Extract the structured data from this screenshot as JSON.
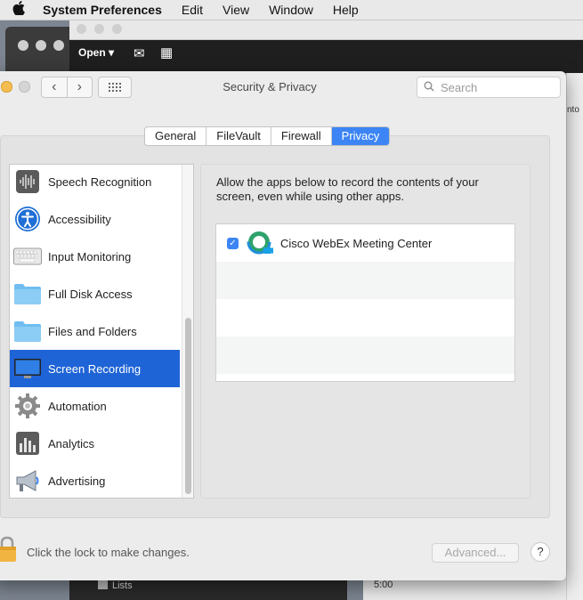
{
  "menubar": {
    "apple_icon": "apple-icon",
    "app_name": "System Preferences",
    "menus": [
      "Edit",
      "View",
      "Window",
      "Help"
    ]
  },
  "background": {
    "open_label": "Open",
    "right_snippet": "nto",
    "lists_label": "Lists",
    "time_label": "5:00"
  },
  "window": {
    "title": "Security & Privacy",
    "search_placeholder": "Search",
    "tabs": [
      {
        "label": "General",
        "active": false
      },
      {
        "label": "FileVault",
        "active": false
      },
      {
        "label": "Firewall",
        "active": false
      },
      {
        "label": "Privacy",
        "active": true
      }
    ],
    "privacy_list": [
      {
        "label": "Speech Recognition",
        "icon": "waveform-icon",
        "selected": false
      },
      {
        "label": "Accessibility",
        "icon": "accessibility-icon",
        "selected": false
      },
      {
        "label": "Input Monitoring",
        "icon": "keyboard-icon",
        "selected": false
      },
      {
        "label": "Full Disk Access",
        "icon": "folder-icon",
        "selected": false
      },
      {
        "label": "Files and Folders",
        "icon": "folder-icon",
        "selected": false
      },
      {
        "label": "Screen Recording",
        "icon": "display-icon",
        "selected": true
      },
      {
        "label": "Automation",
        "icon": "gear-icon",
        "selected": false
      },
      {
        "label": "Analytics",
        "icon": "bar-chart-icon",
        "selected": false
      },
      {
        "label": "Advertising",
        "icon": "megaphone-icon",
        "selected": false
      }
    ],
    "description": "Allow the apps below to record the contents of your screen, even while using other apps.",
    "apps": [
      {
        "name": "Cisco WebEx Meeting Center",
        "checked": true,
        "icon": "webex-icon"
      }
    ],
    "lock_text": "Click the lock to make changes.",
    "advanced_label": "Advanced...",
    "help_label": "?"
  },
  "colors": {
    "accent": "#3d85f5",
    "selection": "#1f64d6",
    "minimize": "#f5bd4f"
  }
}
